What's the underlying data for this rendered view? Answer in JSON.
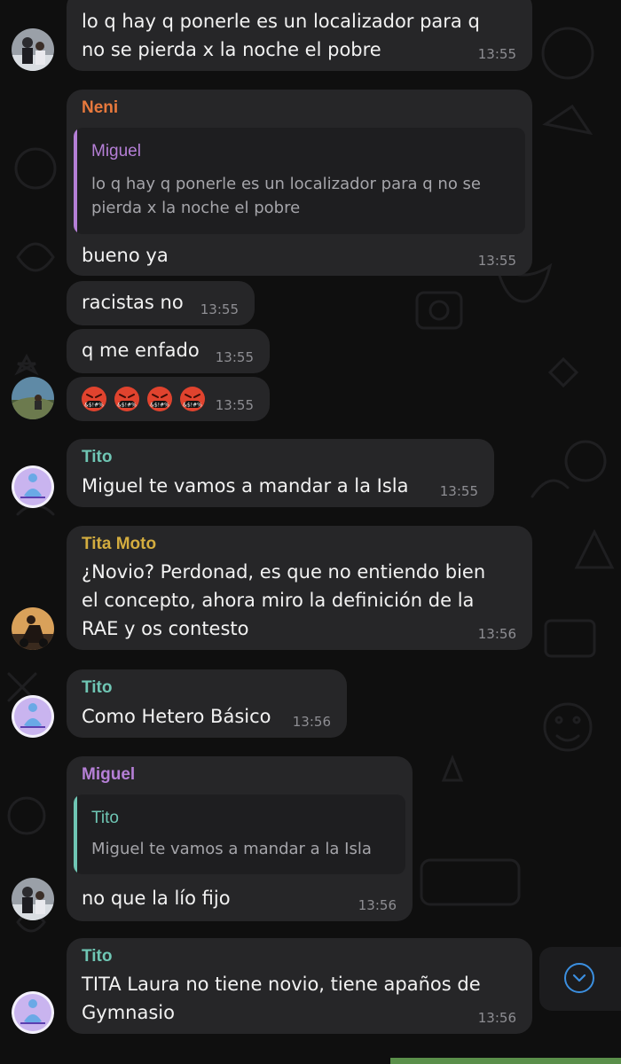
{
  "colors": {
    "bubble": "#262628",
    "neni": "#e8793d",
    "miguel": "#b57fd6",
    "tito": "#6fc6b4",
    "tita_moto": "#d4ad3f",
    "time": "#8e8e93",
    "accent": "#3b8fe0"
  },
  "messages": [
    {
      "text_lines": [
        "lo q hay q ponerle es un localizador para q",
        "no se pierda x la noche el pobre"
      ],
      "time": "13:55"
    },
    {
      "sender": "Neni",
      "reply": {
        "name": "Miguel",
        "lines": [
          "lo q hay q ponerle es un localizador para q no se",
          "pierda x la noche el pobre"
        ]
      },
      "text": "bueno ya",
      "time": "13:55"
    },
    {
      "text": "racistas no",
      "time": "13:55"
    },
    {
      "text": "q me enfado",
      "time": "13:55"
    },
    {
      "emojis": [
        "angry-cursing-face-icon",
        "angry-cursing-face-icon",
        "angry-cursing-face-icon",
        "angry-cursing-face-icon"
      ],
      "time": "13:55"
    },
    {
      "sender": "Tito",
      "text": "Miguel te vamos a mandar a la Isla",
      "time": "13:55"
    },
    {
      "sender": "Tita Moto",
      "text_lines": [
        "¿Novio? Perdonad, es que no entiendo bien",
        "el concepto, ahora miro la definición de la",
        "RAE y os contesto"
      ],
      "time": "13:56"
    },
    {
      "sender": "Tito",
      "text": "Como Hetero Básico",
      "time": "13:56"
    },
    {
      "sender": "Miguel",
      "reply": {
        "name": "Tito",
        "lines": [
          "Miguel te vamos a mandar a la Isla"
        ]
      },
      "text": "no que la lío fijo",
      "time": "13:56"
    },
    {
      "sender": "Tito",
      "text_lines": [
        "TITA Laura no tiene novio, tiene apaños de",
        "Gymnasio"
      ],
      "time": "13:56"
    }
  ],
  "scroll_down_icon": "chevron-down-circle-icon"
}
